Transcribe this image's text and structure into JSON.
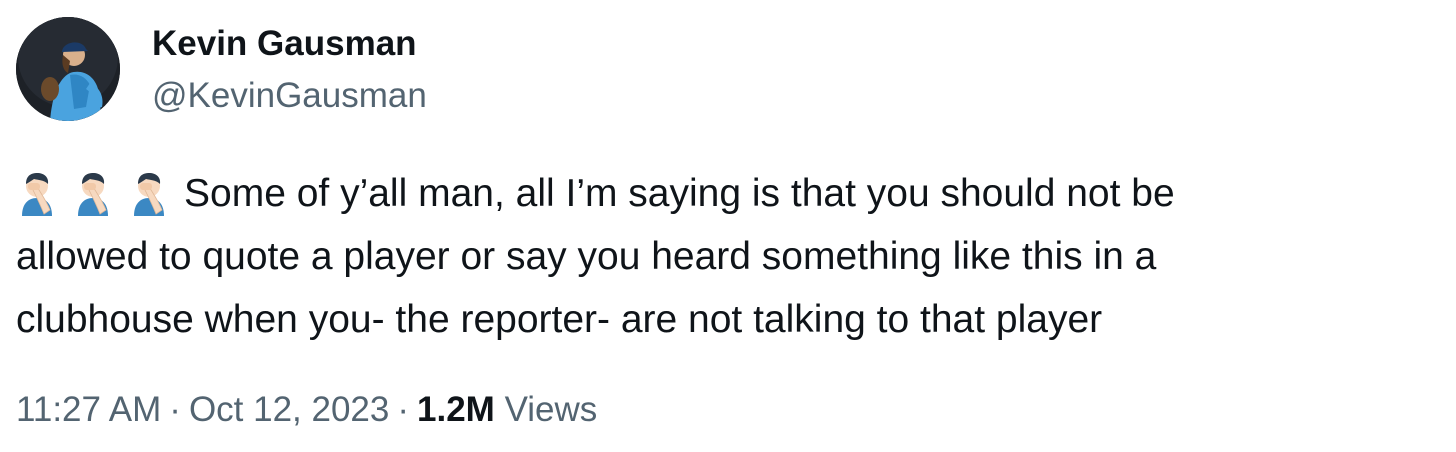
{
  "author": {
    "display_name": "Kevin Gausman",
    "handle": "@KevinGausman"
  },
  "tweet": {
    "emoji": [
      "facepalm-emoji",
      "facepalm-emoji",
      "facepalm-emoji"
    ],
    "lines": [
      "Some of y’all man, all I’m saying is that you should not be",
      "allowed to quote a player or say you heard something like this in a",
      "clubhouse when you- the reporter- are not talking to that player"
    ]
  },
  "meta": {
    "time": "11:27 AM",
    "separator": "·",
    "date": "Oct 12, 2023",
    "views_count": "1.2M",
    "views_label": "Views"
  },
  "colors": {
    "text_primary": "#0f1419",
    "text_secondary": "#536471",
    "emoji_skin": "#f7d9c0",
    "emoji_shirt": "#3b88c3",
    "emoji_hair": "#2b3a4a"
  }
}
